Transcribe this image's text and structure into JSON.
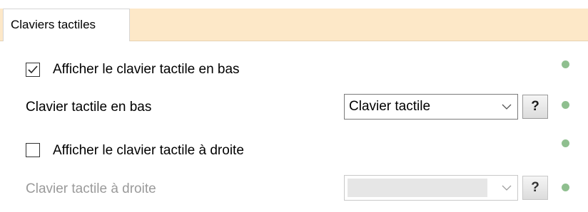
{
  "tab": {
    "label": "Claviers tactiles"
  },
  "rows": {
    "show_bottom": {
      "label": "Afficher le clavier tactile en bas",
      "checked": true
    },
    "bottom_keyboard": {
      "label": "Clavier tactile en bas",
      "value": "Clavier tactile",
      "help": "?"
    },
    "show_right": {
      "label": "Afficher le clavier tactile à droite",
      "checked": false
    },
    "right_keyboard": {
      "label": "Clavier tactile à droite",
      "value": "",
      "help": "?"
    }
  },
  "colors": {
    "tab_strip": "#fde8c8",
    "status_dot": "#8fbf8f",
    "disabled_text": "#9a9a9a"
  },
  "icons": [
    "checkmark-icon",
    "chevron-down-icon",
    "status-dot-icon"
  ]
}
